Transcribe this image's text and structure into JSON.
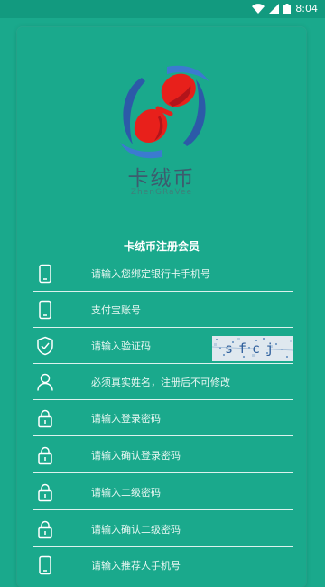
{
  "status": {
    "time": "8:04"
  },
  "brand": {
    "name_cn": "卡绒币",
    "name_en": "ZhenGRaVee"
  },
  "form": {
    "title": "卡绒币注册会员",
    "fields": [
      {
        "hint": "请输入您绑定银行卡手机号",
        "icon": "phone-icon"
      },
      {
        "hint": "支付宝账号",
        "icon": "phone-icon"
      },
      {
        "hint": "请输入验证码",
        "icon": "shield-check-icon"
      },
      {
        "hint": "必须真实姓名，注册后不可修改",
        "icon": "user-icon"
      },
      {
        "hint": "请输入登录密码",
        "icon": "lock-icon"
      },
      {
        "hint": "请输入确认登录密码",
        "icon": "lock-icon"
      },
      {
        "hint": "请输入二级密码",
        "icon": "lock-icon"
      },
      {
        "hint": "请输入确认二级密码",
        "icon": "lock-icon"
      },
      {
        "hint": "请输入推荐人手机号",
        "icon": "phone-icon"
      }
    ],
    "captcha_text": "sfcj"
  },
  "colors": {
    "background": "#1aa98c",
    "logo_red": "#e8201b",
    "logo_blue": "#2c5aa8"
  }
}
